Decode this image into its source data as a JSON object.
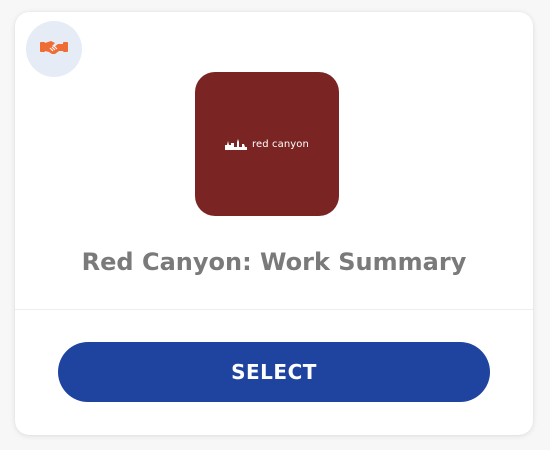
{
  "card": {
    "title": "Red Canyon: Work Summary",
    "badge_icon": "handshake-icon",
    "logo": {
      "text": "red canyon",
      "icon": "canyon-silhouette-icon"
    },
    "select_label": "SELECT"
  },
  "colors": {
    "badge_bg": "#e6ecf5",
    "badge_icon": "#ef6c35",
    "logo_bg": "#7a2523",
    "button_bg": "#1f44a0",
    "title": "#7a7a7a"
  }
}
